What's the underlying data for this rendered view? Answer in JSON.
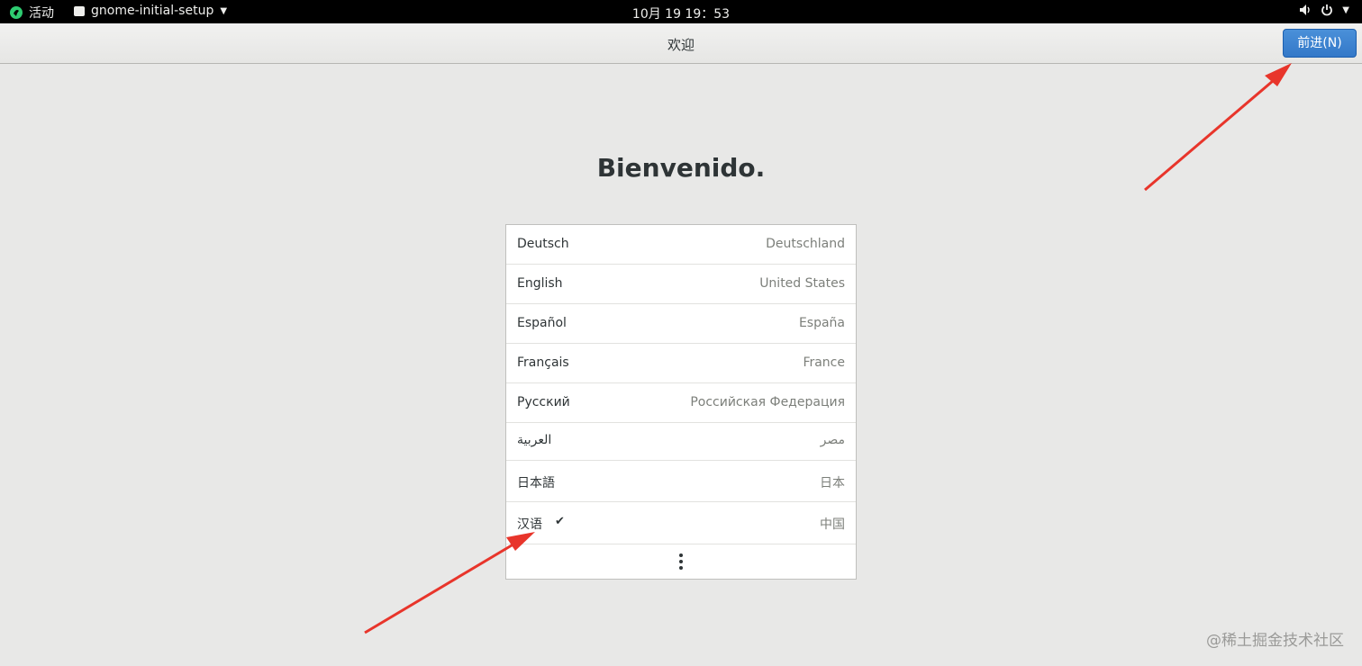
{
  "topbar": {
    "activities_label": "活动",
    "app_menu_label": "gnome-initial-setup",
    "clock": "10月 19  19：53",
    "icons": [
      "gnome-foot-icon",
      "app-window-icon",
      "chevron-down-icon",
      "volume-icon",
      "power-icon",
      "chevron-down-icon"
    ]
  },
  "header": {
    "title": "欢迎",
    "next_button_label": "前进(N)",
    "accent_color": "#3a82d2"
  },
  "welcome_heading": "Bienvenido.",
  "languages": [
    {
      "language": "Deutsch",
      "region": "Deutschland",
      "selected": false
    },
    {
      "language": "English",
      "region": "United States",
      "selected": false
    },
    {
      "language": "Español",
      "region": "España",
      "selected": false
    },
    {
      "language": "Français",
      "region": "France",
      "selected": false
    },
    {
      "language": "Русский",
      "region": "Российская Федерация",
      "selected": false
    },
    {
      "language": "العربية",
      "region": "مصر",
      "selected": false
    },
    {
      "language": "日本語",
      "region": "日本",
      "selected": false
    },
    {
      "language": "汉语",
      "region": "中国",
      "selected": true,
      "check_glyph": "✔"
    }
  ],
  "more_icon": "view-more-icon",
  "annotation_color": "#e8352b",
  "watermark": "@稀土掘金技术社区"
}
